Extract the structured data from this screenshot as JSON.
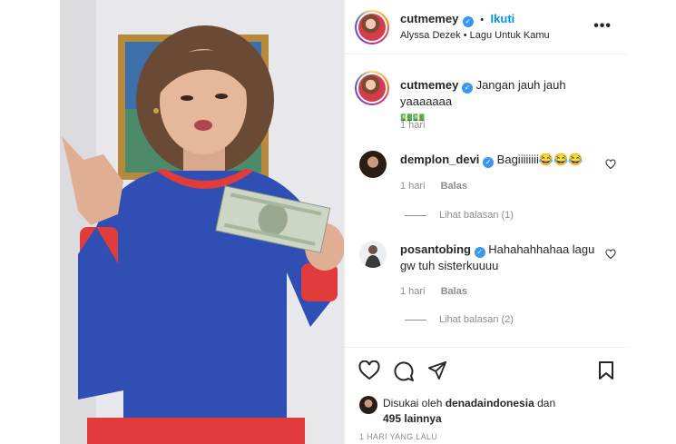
{
  "post": {
    "username": "cutmemey",
    "follow_label": "Ikuti",
    "separator": "•",
    "audio": "Alyssa Dezek • Lagu Untuk Kamu",
    "more_label": "•••"
  },
  "caption": {
    "username": "cutmemey",
    "text": "Jangan jauh jauh yaaaaaaa",
    "emoji": "💵💵",
    "time": "1 hari"
  },
  "comments": [
    {
      "username": "demplon_devi",
      "text": "Bagiiiiiiii😂😂😂",
      "time": "1 hari",
      "reply_label": "Balas",
      "view_replies": "Lihat balasan (1)"
    },
    {
      "username": "posantobing",
      "text": "Hahahahhahaa lagu gw tuh sisterkuuuu",
      "time": "1 hari",
      "reply_label": "Balas",
      "view_replies": "Lihat balasan (2)"
    }
  ],
  "likes": {
    "prefix": "Disukai oleh",
    "user": "denadaindonesia",
    "connector": "dan",
    "others": "495 lainnya"
  },
  "timestamp": "1 HARI YANG LALU",
  "colors": {
    "link": "#0095f6",
    "verified": "#3897f0",
    "text": "#262626",
    "muted": "#8e8e8e"
  }
}
